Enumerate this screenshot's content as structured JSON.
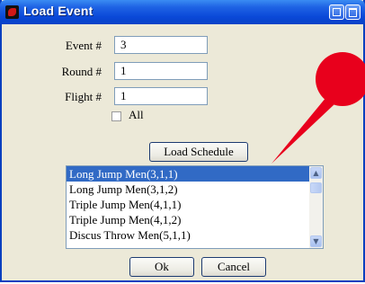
{
  "window": {
    "title": "Load Event",
    "icon": "app-icon"
  },
  "form": {
    "event": {
      "label": "Event #",
      "value": "3"
    },
    "round": {
      "label": "Round #",
      "value": "1"
    },
    "flight": {
      "label": "Flight #",
      "value": "1"
    },
    "all": {
      "label": "All",
      "checked": false
    }
  },
  "load_schedule_label": "Load Schedule",
  "schedule_list": {
    "items": [
      "Long Jump Men(3,1,1)",
      "Long Jump Men(3,1,2)",
      "Triple Jump Men(4,1,1)",
      "Triple Jump Men(4,1,2)",
      "Discus Throw Men(5,1,1)"
    ],
    "selected_index": 0
  },
  "buttons": {
    "ok": "Ok",
    "cancel": "Cancel"
  },
  "colors": {
    "titlebar": "#0a48d8",
    "selection": "#316ac5",
    "pin": "#e8001c",
    "dialog_bg": "#ece9d8"
  }
}
